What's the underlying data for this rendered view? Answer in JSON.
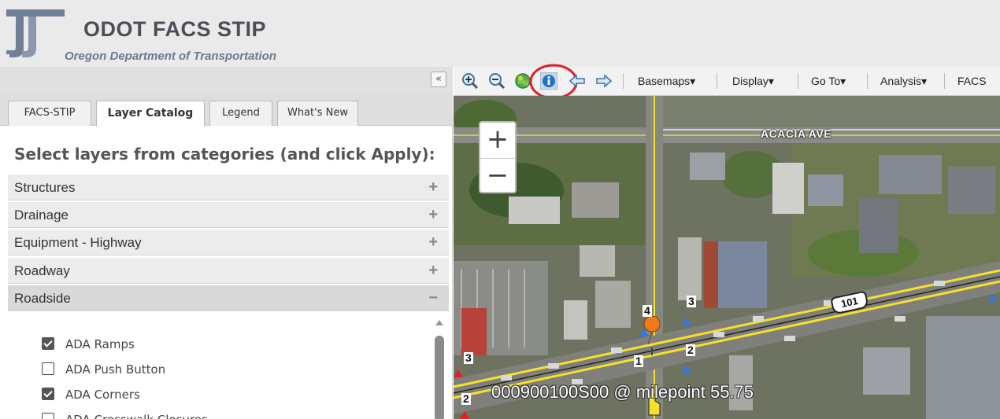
{
  "header": {
    "title": "ODOT FACS STIP",
    "organization": "Oregon Department of Transportation"
  },
  "panel": {
    "collapse_label": "«",
    "tabs": [
      {
        "label": "FACS-STIP",
        "active": false
      },
      {
        "label": "Layer Catalog",
        "active": true
      },
      {
        "label": "Legend",
        "active": false
      },
      {
        "label": "What's New",
        "active": false
      }
    ],
    "heading": "Select layers from categories (and click Apply):",
    "categories": [
      {
        "label": "Structures",
        "icon": "+"
      },
      {
        "label": "Drainage",
        "icon": "+"
      },
      {
        "label": "Equipment - Highway",
        "icon": "+"
      },
      {
        "label": "Roadway",
        "icon": "+"
      },
      {
        "label": "Roadside",
        "icon": "−"
      }
    ],
    "layers": [
      {
        "label": "ADA Ramps",
        "checked": true
      },
      {
        "label": "ADA Push Button",
        "checked": false
      },
      {
        "label": "ADA Corners",
        "checked": true
      },
      {
        "label": "ADA Crosswalk Closures",
        "checked": false
      }
    ]
  },
  "toolbar": {
    "menus": [
      "Basemaps",
      "Display",
      "Go To",
      "Analysis",
      "FACS"
    ],
    "dropdown_caret": "▾"
  },
  "map": {
    "zoom_in_label": "+",
    "zoom_out_label": "−",
    "street_label": "ACACIA AVE",
    "highway_shield": "101",
    "milepoint_label": "000900100S00 @ milepoint 55.75",
    "marker_numbers": [
      "4",
      "3",
      "2",
      "1",
      "3",
      "2"
    ]
  },
  "colors": {
    "highlight_circle": "#e0202a",
    "highway_line": "#f5e12a",
    "marker_orange": "#f07a1a",
    "triangle_blue": "#2f7ae5"
  }
}
